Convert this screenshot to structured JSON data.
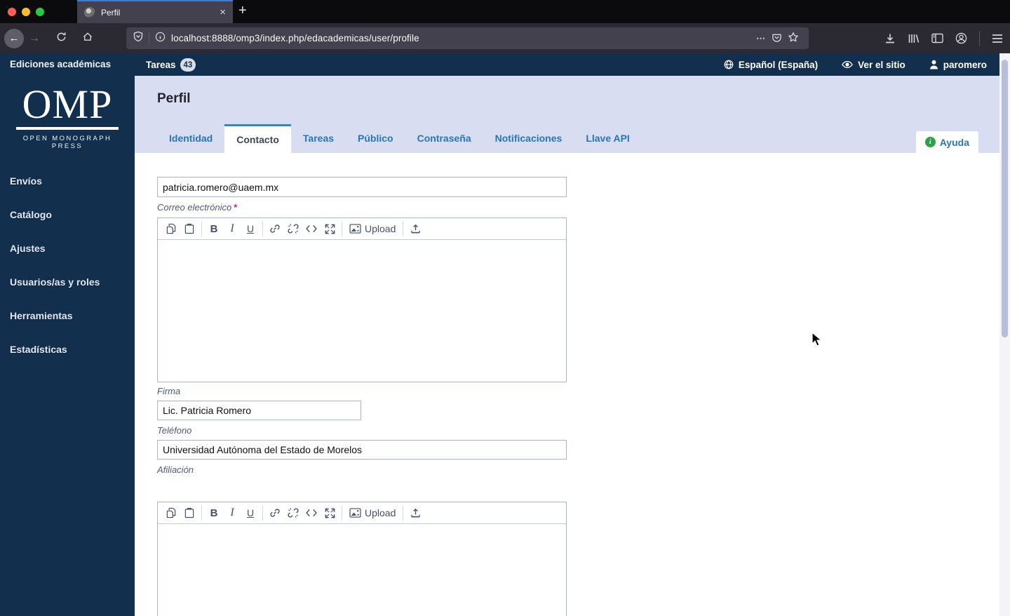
{
  "browser": {
    "tab_title": "Perfil",
    "url": "localhost:8888/omp3/index.php/edacademicas/user/profile",
    "icons": {
      "close_tab": "×",
      "new_tab": "+",
      "back": "←",
      "forward": "→",
      "more": "⋯"
    }
  },
  "topbar": {
    "press_name": "Ediciones académicas",
    "tasks_label": "Tareas",
    "tasks_count": "43",
    "language": "Español (España)",
    "view_site": "Ver el sitio",
    "username": "paromero"
  },
  "sidebar": {
    "logo_title": "OMP",
    "logo_subtitle": "OPEN MONOGRAPH PRESS",
    "items": [
      {
        "label": "Envíos"
      },
      {
        "label": "Catálogo"
      },
      {
        "label": "Ajustes"
      },
      {
        "label": "Usuarios/as y roles"
      },
      {
        "label": "Herramientas"
      },
      {
        "label": "Estadísticas"
      }
    ]
  },
  "main": {
    "page_title": "Perfil",
    "tabs": [
      {
        "label": "Identidad",
        "active": false
      },
      {
        "label": "Contacto",
        "active": true
      },
      {
        "label": "Tareas",
        "active": false
      },
      {
        "label": "Público",
        "active": false
      },
      {
        "label": "Contraseña",
        "active": false
      },
      {
        "label": "Notificaciones",
        "active": false
      },
      {
        "label": "Llave API",
        "active": false
      }
    ],
    "help_label": "Ayuda",
    "form": {
      "email": {
        "value": "patricia.romero@uaem.mx",
        "label": "Correo electrónico",
        "required": "*"
      },
      "signature": {
        "value": "",
        "label": "Firma"
      },
      "phone": {
        "value": "Lic. Patricia Romero",
        "label": "Teléfono"
      },
      "affiliation": {
        "value": "Universidad Autónoma del Estado de Morelos",
        "label": "Afiliación"
      },
      "mailing": {
        "value": ""
      },
      "editor_upload_label": "Upload"
    }
  },
  "colors": {
    "navy": "#12304e",
    "header_lavender": "#d9ddf1",
    "tab_blue": "#2676b8",
    "accent_blue": "#2f86c2",
    "required_magenta": "#d4208c",
    "help_green": "#2ba345"
  }
}
